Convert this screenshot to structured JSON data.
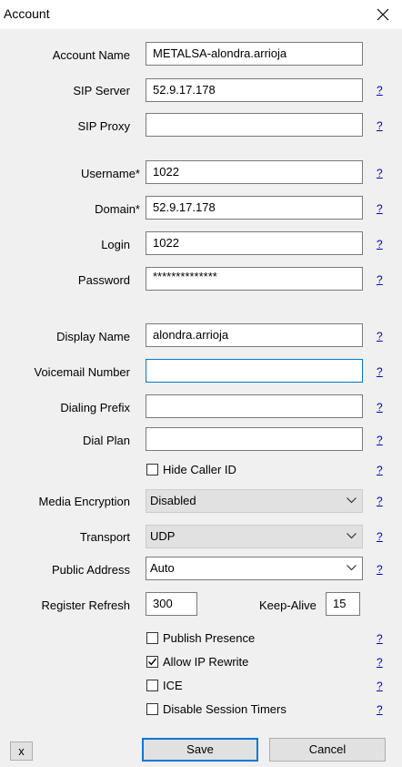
{
  "window": {
    "title": "Account"
  },
  "labels": {
    "account_name": "Account Name",
    "sip_server": "SIP Server",
    "sip_proxy": "SIP Proxy",
    "username": "Username*",
    "domain": "Domain*",
    "login": "Login",
    "password": "Password",
    "display_name": "Display Name",
    "voicemail_number": "Voicemail Number",
    "dialing_prefix": "Dialing Prefix",
    "dial_plan": "Dial Plan",
    "media_encryption": "Media Encryption",
    "transport": "Transport",
    "public_address": "Public Address",
    "register_refresh": "Register Refresh",
    "keep_alive": "Keep-Alive"
  },
  "values": {
    "account_name": "METALSA-alondra.arrioja",
    "sip_server": "52.9.17.178",
    "sip_proxy": "",
    "username": "1022",
    "domain": "52.9.17.178",
    "login": "1022",
    "password": "**************",
    "display_name": "alondra.arrioja",
    "voicemail_number": "",
    "dialing_prefix": "",
    "dial_plan": "",
    "media_encryption": "Disabled",
    "transport": "UDP",
    "public_address": "Auto",
    "register_refresh": "300",
    "keep_alive": "15"
  },
  "checkboxes": {
    "hide_caller_id": {
      "label": "Hide Caller ID",
      "checked": false
    },
    "publish_presence": {
      "label": "Publish Presence",
      "checked": false
    },
    "allow_ip_rewrite": {
      "label": "Allow IP Rewrite",
      "checked": true
    },
    "ice": {
      "label": "ICE",
      "checked": false
    },
    "disable_session_timers": {
      "label": "Disable Session Timers",
      "checked": false
    }
  },
  "help_link": "?",
  "buttons": {
    "x": "x",
    "save": "Save",
    "cancel": "Cancel"
  },
  "icons": {
    "close": "close-icon",
    "chevron": "chevron-down-icon",
    "check": "checkmark-icon"
  },
  "colors": {
    "focus": "#0078d7",
    "help_link": "#0000cc"
  }
}
